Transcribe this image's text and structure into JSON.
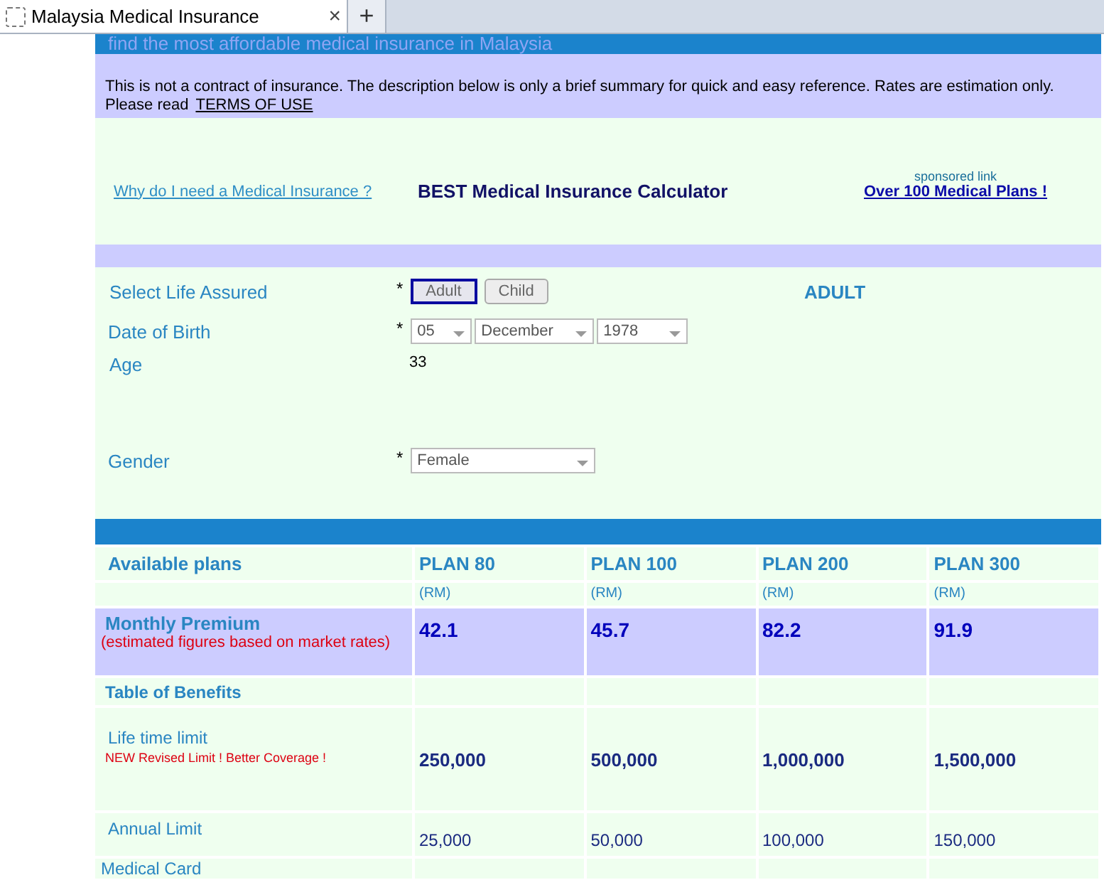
{
  "browser": {
    "tab_title": "Malaysia Medical Insurance",
    "close_glyph": "×",
    "new_tab_glyph": "+"
  },
  "header": {
    "tagline": "find the most affordable medical insurance in Malaysia"
  },
  "disclaimer": {
    "text": "This is not a contract of insurance. The description below  is only a brief summary for quick and easy reference. Rates are estimation only.",
    "read_prefix": "Please read",
    "terms_link": "TERMS OF USE"
  },
  "intro": {
    "why_link": "Why do I need a Medical Insurance ?",
    "title": "BEST Medical Insurance Calculator",
    "sponsored_label": "sponsored link",
    "sponsored_link": "Over 100 Medical Plans !"
  },
  "form": {
    "life_assured": {
      "label": "Select Life Assured",
      "required": "*",
      "options": [
        {
          "label": "Adult",
          "selected": true
        },
        {
          "label": "Child",
          "selected": false
        }
      ],
      "result": "ADULT"
    },
    "date_of_birth": {
      "label": "Date of Birth",
      "required": "*",
      "day": "05",
      "month": "December",
      "year": "1978"
    },
    "age": {
      "label": "Age",
      "value": "33"
    },
    "gender": {
      "label": "Gender",
      "required": "*",
      "value": "Female"
    }
  },
  "plans": {
    "heading": "Available plans",
    "columns": [
      {
        "name": "PLAN 80",
        "unit": "(RM)",
        "premium": "42.1",
        "lifetime": "250,000",
        "annual": "25,000"
      },
      {
        "name": "PLAN 100",
        "unit": "(RM)",
        "premium": "45.7",
        "lifetime": "500,000",
        "annual": "50,000"
      },
      {
        "name": "PLAN 200",
        "unit": "(RM)",
        "premium": "82.2",
        "lifetime": "1,000,000",
        "annual": "100,000"
      },
      {
        "name": "PLAN 300",
        "unit": "(RM)",
        "premium": "91.9",
        "lifetime": "1,500,000",
        "annual": "150,000"
      }
    ],
    "premium_label": "Monthly Premium",
    "premium_note": "(estimated figures based on market rates)",
    "benefits_heading": "Table of Benefits",
    "lifetime_label": "Life time limit",
    "lifetime_note": "NEW Revised Limit ! Better Coverage !",
    "annual_label": "Annual Limit",
    "next_row_label": "Medical Card"
  }
}
